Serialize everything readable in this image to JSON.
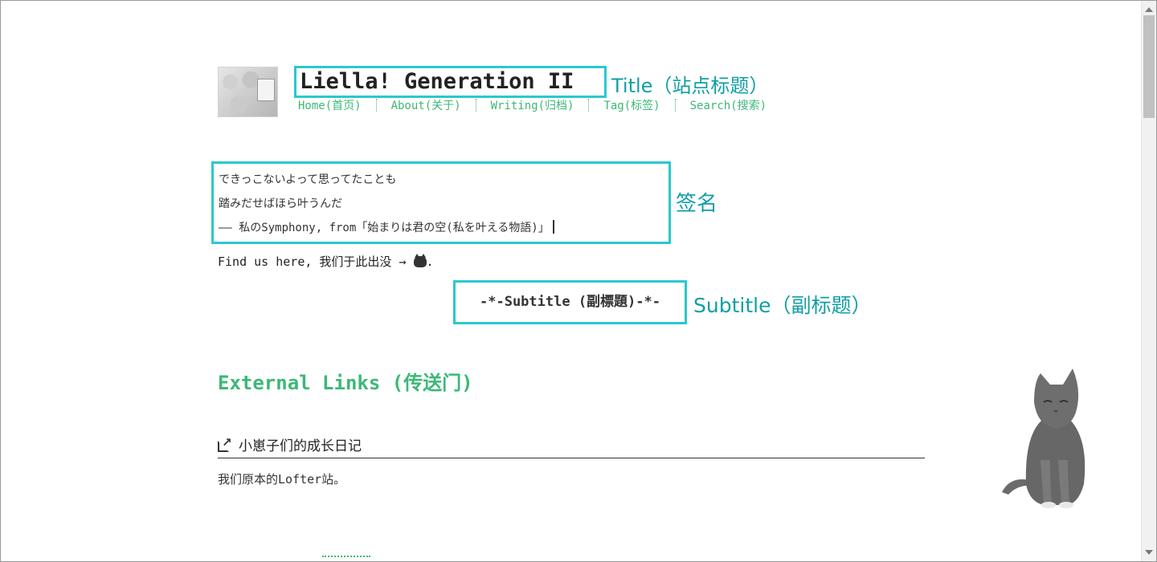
{
  "header": {
    "site_title": "Liella! Generation II",
    "title_annotation": "Title（站点标题）",
    "nav": [
      {
        "label": "Home(首页)"
      },
      {
        "label": "About(关于)"
      },
      {
        "label": "Writing(归档)"
      },
      {
        "label": "Tag(标签)"
      },
      {
        "label": "Search(搜索)"
      }
    ]
  },
  "signature": {
    "lines": [
      "できっこないよって思ってたことも",
      "踏みだせばほら叶うんだ",
      "—— 私のSymphony, from「始まりは君の空(私を叶える物語)」"
    ],
    "annotation": "签名"
  },
  "find_us": {
    "text": "Find us here, 我们于此出没 →",
    "end": "."
  },
  "subtitle": {
    "text": "-*-Subtitle (副標題)-*-",
    "annotation": "Subtitle（副标题）"
  },
  "external_links": {
    "heading": "External Links (传送门)",
    "items": [
      {
        "title": "小崽子们的成长日记",
        "description": "我们原本的Lofter站。"
      }
    ]
  },
  "colors": {
    "accent_green": "#3cb878",
    "annotation_cyan": "#2ac8d0",
    "annotation_text": "#119fa6"
  },
  "icons": [
    "github-icon",
    "external-link-icon",
    "cat-mascot"
  ]
}
